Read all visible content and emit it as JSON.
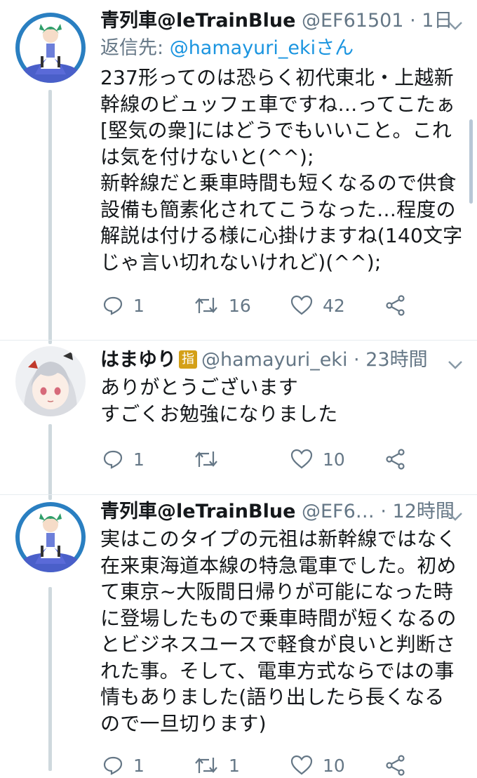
{
  "tweets": [
    {
      "name": "青列車@leTrainBlue",
      "handle": "@EF61501",
      "time": "· 1日",
      "replying_label": "返信先: ",
      "replying_to": "@hamayuri_ekiさん",
      "text": "237形ってのは恐らく初代東北・上越新\n幹線のビュッフェ車ですね…ってこたぁ\n[堅気の衆]にはどうでもいいこと。これ\nは気を付けないと(^^);\n新幹線だと乗車時間も短くなるので供食\n設備も簡素化されてこうなった…程度の\n解説は付ける様に心掛けますね(140文字\nじゃ言い切れないけれど)(^^);",
      "reply_count": "1",
      "retweet_count": "16",
      "like_count": "42",
      "avatar_icon": "maid-character-avatar"
    },
    {
      "name": "はまゆり",
      "badge": "指",
      "handle": "@hamayuri_eki",
      "time": "· 23時間",
      "text": "ありがとうございます\nすごくお勉強になりました",
      "reply_count": "1",
      "retweet_count": "",
      "like_count": "10",
      "avatar_icon": "silver-hair-girl-avatar"
    },
    {
      "name": "青列車@leTrainBlue",
      "handle": "@EF6…",
      "time": "· 12時間",
      "text": "実はこのタイプの元祖は新幹線ではなく\n在来東海道本線の特急電車でした。初め\nて東京~大阪間日帰りが可能になった時\nに登場したもので乗車時間が短くなるの\nとビジネスユースで軽食が良いと判断さ\nれた事。そして、電車方式ならではの事\n情もありました(語り出したら長くなる\nので一旦切ります)",
      "reply_count": "1",
      "retweet_count": "1",
      "like_count": "10",
      "avatar_icon": "maid-character-avatar"
    }
  ],
  "colors": {
    "text": "#14171a",
    "secondary": "#657786",
    "link": "#1b95e0",
    "thread_line": "#cfd9de",
    "divider": "#e6ecf0"
  }
}
